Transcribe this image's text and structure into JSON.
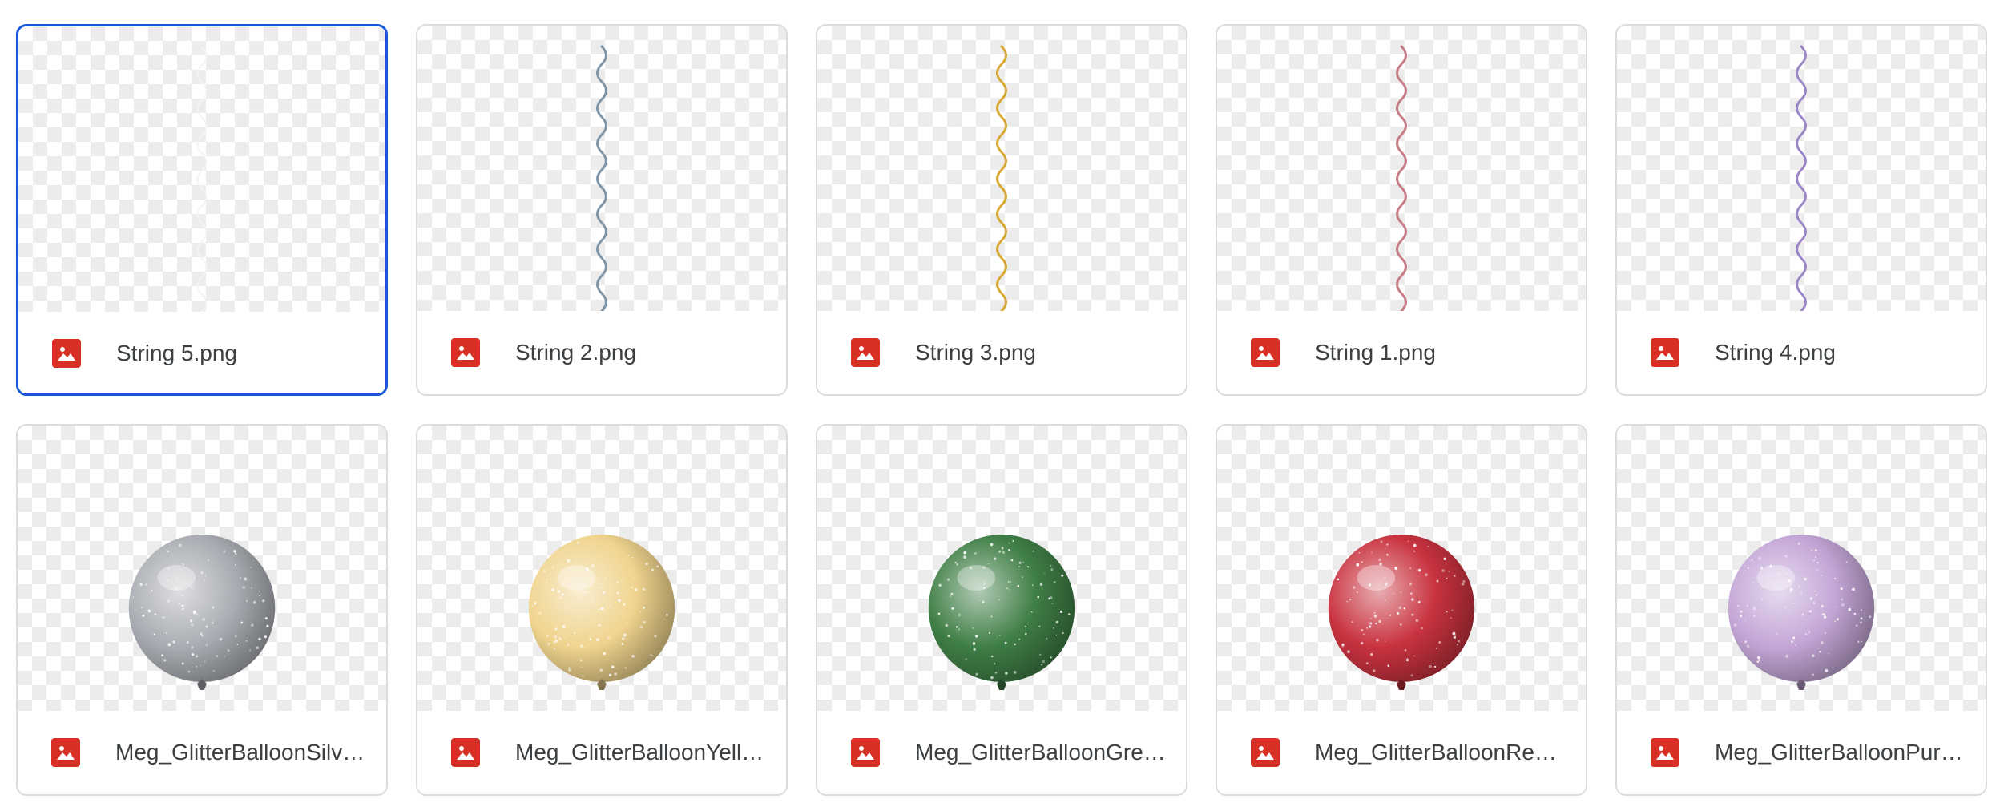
{
  "files": [
    {
      "name": "String 5.png",
      "kind": "string",
      "color": "#f4f4f4",
      "selected": true,
      "icon": "image-file-icon"
    },
    {
      "name": "String 2.png",
      "kind": "string",
      "color": "#7f95a8",
      "selected": false,
      "icon": "image-file-icon"
    },
    {
      "name": "String 3.png",
      "kind": "string",
      "color": "#d8a832",
      "selected": false,
      "icon": "image-file-icon"
    },
    {
      "name": "String 1.png",
      "kind": "string",
      "color": "#c77d86",
      "selected": false,
      "icon": "image-file-icon"
    },
    {
      "name": "String 4.png",
      "kind": "string",
      "color": "#9b86c6",
      "selected": false,
      "icon": "image-file-icon"
    },
    {
      "name": "Meg_GlitterBalloonSilv…",
      "kind": "balloon",
      "color": "#a9acb2",
      "selected": false,
      "icon": "image-file-icon"
    },
    {
      "name": "Meg_GlitterBalloonYell…",
      "kind": "balloon",
      "color": "#f0d48e",
      "selected": false,
      "icon": "image-file-icon"
    },
    {
      "name": "Meg_GlitterBalloonGre…",
      "kind": "balloon",
      "color": "#3f7e46",
      "selected": false,
      "icon": "image-file-icon"
    },
    {
      "name": "Meg_GlitterBalloonRed…",
      "kind": "balloon",
      "color": "#c8323f",
      "selected": false,
      "icon": "image-file-icon"
    },
    {
      "name": "Meg_GlitterBalloonPur…",
      "kind": "balloon",
      "color": "#c3a6d6",
      "selected": false,
      "icon": "image-file-icon"
    }
  ],
  "colors": {
    "selection_border": "#1a56db",
    "card_border": "#dadce0",
    "file_icon": "#d93025",
    "text": "#3c4043"
  }
}
